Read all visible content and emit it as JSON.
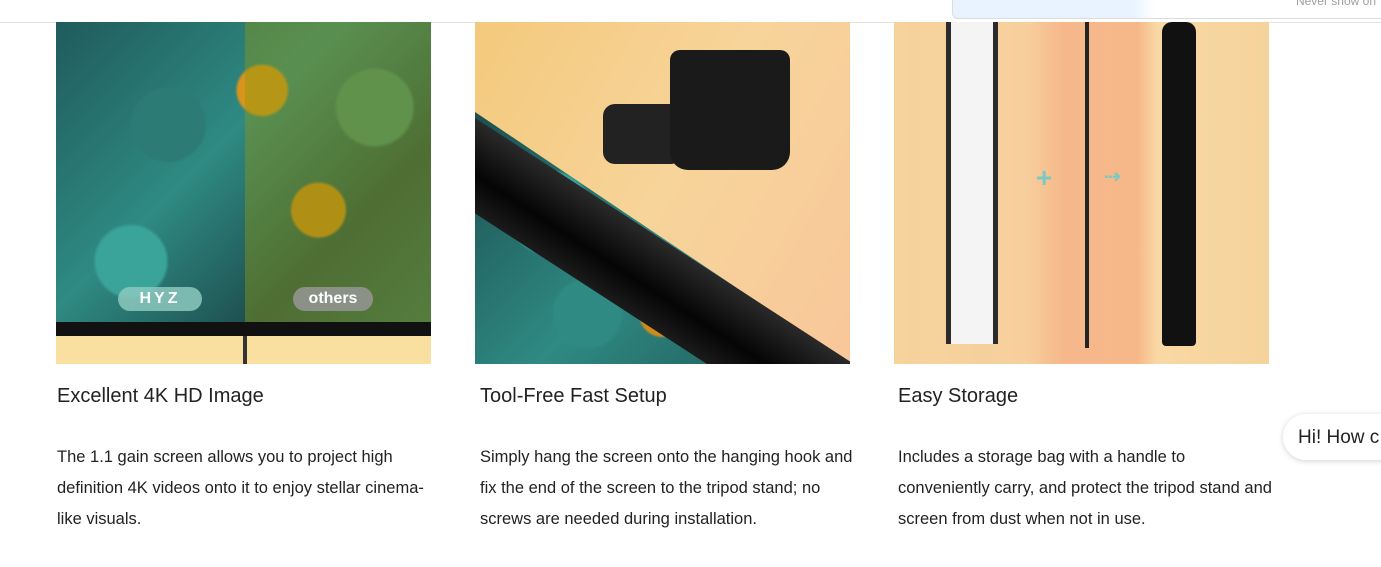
{
  "popup": {
    "text": "Never show on"
  },
  "cards": [
    {
      "title": "Excellent 4K HD Image",
      "description": "The 1.1 gain screen allows you to project high definition 4K videos onto it to enjoy stellar cinema-like visuals.",
      "image_labels": [
        "HYZ",
        "others"
      ]
    },
    {
      "title": "Tool-Free Fast Setup",
      "description": "Simply hang the screen onto the hanging hook and fix the end of the screen to the tripod stand; no screws are needed during installation."
    },
    {
      "title": "Easy Storage",
      "description": "Includes a storage bag with a handle to conveniently carry, and protect the tripod stand and screen from dust when not in use."
    }
  ],
  "chat": {
    "greeting": "Hi! How c"
  }
}
